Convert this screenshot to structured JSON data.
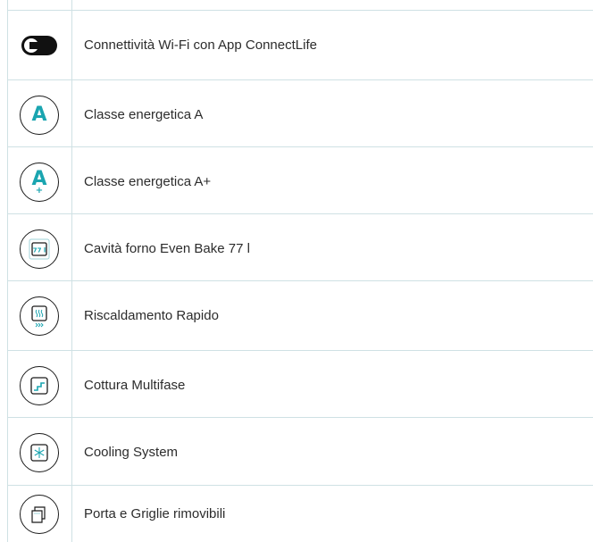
{
  "features": [
    {
      "icon": "connectlife-icon",
      "label": "Connettività Wi-Fi con App ConnectLife"
    },
    {
      "icon": "energy-class-a-icon",
      "label": "Classe energetica A",
      "letter": "A"
    },
    {
      "icon": "energy-class-a-plus-icon",
      "label": "Classe energetica A+",
      "letter": "A",
      "plus": "+"
    },
    {
      "icon": "oven-cavity-icon",
      "label": "Cavità forno Even Bake 77 l",
      "badge": "77 l"
    },
    {
      "icon": "rapid-heating-icon",
      "label": "Riscaldamento Rapido"
    },
    {
      "icon": "multistep-cooking-icon",
      "label": "Cottura Multifase"
    },
    {
      "icon": "cooling-system-icon",
      "label": "Cooling System"
    },
    {
      "icon": "removable-door-icon",
      "label": "Porta e Griglie rimovibili"
    }
  ],
  "colors": {
    "accent": "#1aa5b0",
    "border": "#cfe1e4",
    "text": "#2c2c2c"
  }
}
